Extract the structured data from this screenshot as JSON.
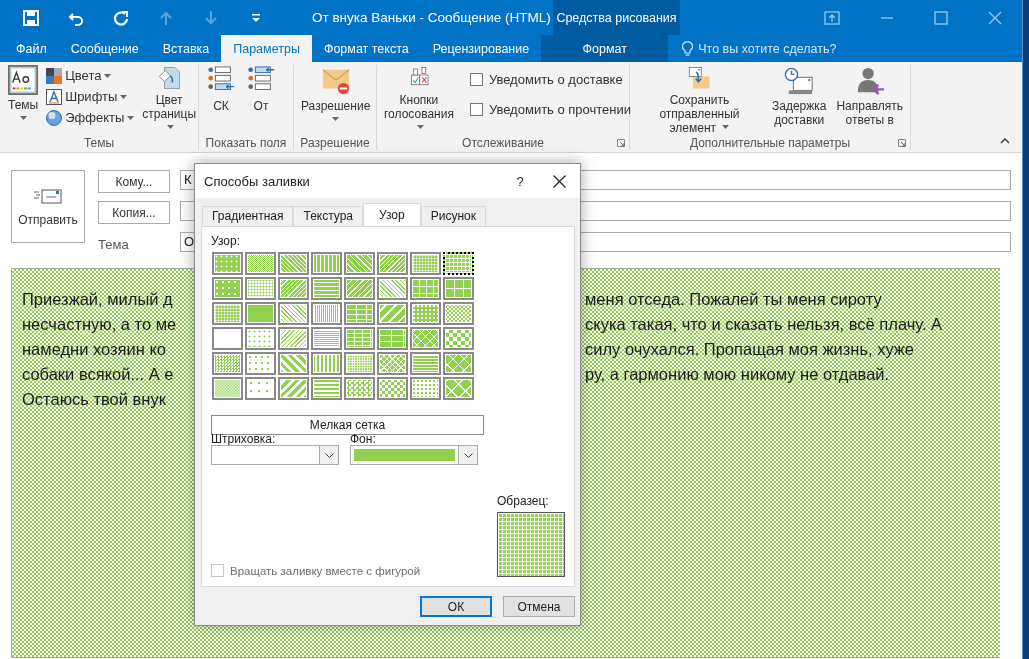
{
  "window": {
    "title": "От внука Ваньки - Сообщение (HTML)",
    "context_group": "Средства рисования"
  },
  "quick_access": [
    {
      "kind": "save",
      "disabled": false
    },
    {
      "kind": "undo",
      "disabled": false
    },
    {
      "kind": "redo",
      "disabled": false
    },
    {
      "kind": "up",
      "disabled": true
    },
    {
      "kind": "down",
      "disabled": true
    },
    {
      "kind": "customize",
      "disabled": false
    }
  ],
  "tabs": [
    {
      "label": "Файл",
      "selected": false,
      "contextual": false
    },
    {
      "label": "Сообщение",
      "selected": false,
      "contextual": false
    },
    {
      "label": "Вставка",
      "selected": false,
      "contextual": false
    },
    {
      "label": "Параметры",
      "selected": true,
      "contextual": false
    },
    {
      "label": "Формат текста",
      "selected": false,
      "contextual": false
    },
    {
      "label": "Рецензирование",
      "selected": false,
      "contextual": false
    },
    {
      "label": "Формат",
      "selected": false,
      "contextual": true
    }
  ],
  "tell_me": {
    "placeholder": "Что вы хотите сделать?"
  },
  "ribbon_groups": [
    {
      "label": "Темы",
      "launcher": false,
      "items": [
        {
          "kind": "large",
          "label": "Темы",
          "dropdown": true
        },
        {
          "kind": "stack",
          "items": [
            {
              "label": "Цвета",
              "dropdown": true
            },
            {
              "label": "Шрифты",
              "dropdown": true
            },
            {
              "label": "Эффекты",
              "dropdown": true
            }
          ]
        },
        {
          "kind": "large",
          "label": "Цвет\nстраницы",
          "dropdown": true
        }
      ]
    },
    {
      "label": "Показать поля",
      "launcher": false,
      "items": [
        {
          "kind": "large",
          "label": "СК",
          "dropdown": false
        },
        {
          "kind": "large",
          "label": "От",
          "dropdown": false
        }
      ]
    },
    {
      "label": "Разрешение",
      "launcher": false,
      "items": [
        {
          "kind": "large",
          "label": "Разрешение",
          "dropdown": true
        }
      ]
    },
    {
      "label": "Отслеживание",
      "launcher": true,
      "items": [
        {
          "kind": "large",
          "label": "Кнопки\nголосования",
          "dropdown": true
        },
        {
          "kind": "checks",
          "items": [
            {
              "label": "Уведомить о доставке",
              "checked": false
            },
            {
              "label": "Уведомить о прочтении",
              "checked": false
            }
          ]
        }
      ]
    },
    {
      "label": "Дополнительные параметры",
      "launcher": true,
      "items": [
        {
          "kind": "large",
          "label": "Сохранить отправленный\nэлемент",
          "dropdown": true
        },
        {
          "kind": "large",
          "label": "Задержка\nдоставки",
          "dropdown": false
        },
        {
          "kind": "large",
          "label": "Направлять\nответы в",
          "dropdown": false
        }
      ]
    }
  ],
  "compose": {
    "send_button": "Отправить",
    "to_button": "Кому...",
    "cc_button": "Копия...",
    "subject_label": "Тема",
    "to_value": "К",
    "subject_value": "О"
  },
  "body_lines": [
    {
      "left": "Приезжай, милый д",
      "right": "меня отседа. Пожалей ты меня сироту"
    },
    {
      "left": "несчастную, а то ме",
      "right": "скука такая, что и сказать нельзя, всё плачу. А"
    },
    {
      "left": "намедни хозяин ко",
      "right": "силу очухался. Пропащая моя жизнь, хуже"
    },
    {
      "left": "собаки всякой... А е",
      "right": "ру, а гармонию мою никому не отдавай."
    },
    {
      "left": "Остаюсь твой внук"
    }
  ],
  "dialog": {
    "title": "Способы заливки",
    "help": "?",
    "tabs": [
      {
        "label": "Градиентная",
        "selected": false
      },
      {
        "label": "Текстура",
        "selected": false
      },
      {
        "label": "Узор",
        "selected": true
      },
      {
        "label": "Рисунок",
        "selected": false
      }
    ],
    "pattern_label": "Узор:",
    "patterns": [
      {
        "selected": false
      },
      {
        "selected": false
      },
      {
        "selected": false
      },
      {
        "selected": false
      },
      {
        "selected": false
      },
      {
        "selected": false
      },
      {
        "selected": false
      },
      {
        "selected": true
      },
      {
        "selected": false
      },
      {
        "selected": false
      },
      {
        "selected": false
      },
      {
        "selected": false
      },
      {
        "selected": false
      },
      {
        "selected": false
      },
      {
        "selected": false
      },
      {
        "selected": false
      },
      {
        "selected": false
      },
      {
        "selected": false
      },
      {
        "selected": false
      },
      {
        "selected": false
      },
      {
        "selected": false
      },
      {
        "selected": false
      },
      {
        "selected": false
      },
      {
        "selected": false
      },
      {
        "selected": false
      },
      {
        "selected": false
      },
      {
        "selected": false
      },
      {
        "selected": false
      },
      {
        "selected": false
      },
      {
        "selected": false
      },
      {
        "selected": false
      },
      {
        "selected": false
      },
      {
        "selected": false
      },
      {
        "selected": false
      },
      {
        "selected": false
      },
      {
        "selected": false
      },
      {
        "selected": false
      },
      {
        "selected": false
      },
      {
        "selected": false
      },
      {
        "selected": false
      },
      {
        "selected": false
      },
      {
        "selected": false
      },
      {
        "selected": false
      },
      {
        "selected": false
      },
      {
        "selected": false
      },
      {
        "selected": false
      },
      {
        "selected": false
      },
      {
        "selected": false
      }
    ],
    "pattern_name": "Мелкая сетка",
    "foreground": {
      "label": "Штриховка:",
      "color": "#ffffff"
    },
    "background": {
      "label": "Фон:",
      "color": "#92d050"
    },
    "sample_label": "Образец:",
    "rotate": {
      "label": "Вращать заливку вместе с фигурой",
      "checked": false,
      "disabled": true
    },
    "buttons": [
      {
        "label": "ОК",
        "default": true
      },
      {
        "label": "Отмена",
        "default": false
      }
    ]
  }
}
